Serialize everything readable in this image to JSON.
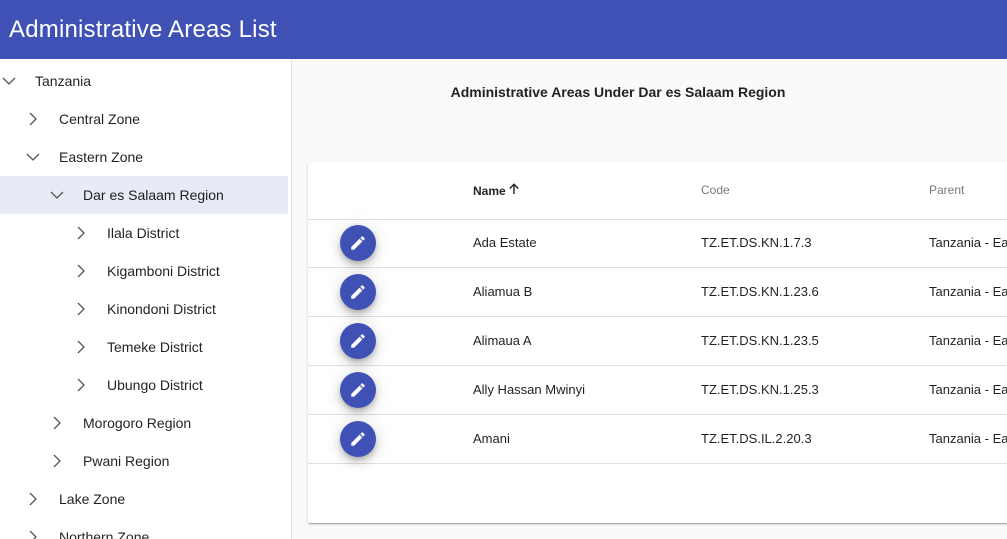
{
  "header": {
    "title": "Administrative Areas List"
  },
  "sidebar": {
    "nodes": [
      {
        "label": "Tanzania",
        "state": "expanded"
      },
      {
        "label": "Central Zone",
        "state": "collapsed"
      },
      {
        "label": "Eastern Zone",
        "state": "expanded"
      },
      {
        "label": "Dar es Salaam Region",
        "state": "expanded",
        "selected": true
      },
      {
        "label": "Ilala District",
        "state": "collapsed"
      },
      {
        "label": "Kigamboni District",
        "state": "collapsed"
      },
      {
        "label": "Kinondoni District",
        "state": "collapsed"
      },
      {
        "label": "Temeke District",
        "state": "collapsed"
      },
      {
        "label": "Ubungo District",
        "state": "collapsed"
      },
      {
        "label": "Morogoro Region",
        "state": "collapsed"
      },
      {
        "label": "Pwani Region",
        "state": "collapsed"
      },
      {
        "label": "Lake Zone",
        "state": "collapsed"
      },
      {
        "label": "Northern Zone",
        "state": "collapsed"
      }
    ]
  },
  "main": {
    "section_title": "Administrative Areas Under Dar es Salaam Region",
    "table": {
      "columns": {
        "name": "Name",
        "code": "Code",
        "parent": "Parent"
      },
      "sort": {
        "column": "name",
        "direction": "ascending",
        "icon": "arrow-up-icon"
      },
      "rows": [
        {
          "name": "Ada Estate",
          "code": "TZ.ET.DS.KN.1.7.3",
          "parent": "Tanzania - Ea"
        },
        {
          "name": "Aliamua B",
          "code": "TZ.ET.DS.KN.1.23.6",
          "parent": "Tanzania - Ea"
        },
        {
          "name": "Alimaua A",
          "code": "TZ.ET.DS.KN.1.23.5",
          "parent": "Tanzania - Ea"
        },
        {
          "name": "Ally Hassan Mwinyi",
          "code": "TZ.ET.DS.KN.1.25.3",
          "parent": "Tanzania - Ea"
        },
        {
          "name": "Amani",
          "code": "TZ.ET.DS.IL.2.20.3",
          "parent": "Tanzania - Ea"
        }
      ],
      "row_action_icon": "pencil-icon"
    }
  },
  "colors": {
    "primary": "#3f51b5",
    "selected_bg": "#e8eaf6"
  }
}
